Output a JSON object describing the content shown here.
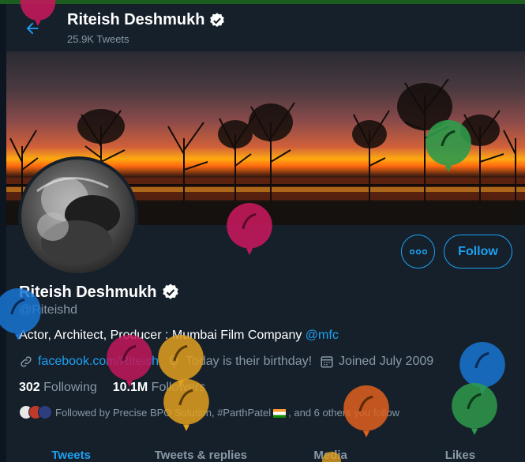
{
  "header": {
    "name": "Riteish Deshmukh",
    "tweet_count": "25.9K Tweets"
  },
  "profile": {
    "name": "Riteish Deshmukh",
    "handle": "@Riteishd",
    "bio_text": "Actor, Architect, Producer : Mumbai Film Company ",
    "bio_mention": "@mfc",
    "website": "facebook.com/Riteish",
    "birthday": "Today is their birthday!",
    "joined": "Joined July 2009",
    "following_count": "302",
    "following_label": "Following",
    "followers_count": "10.1M",
    "followers_label": "Followers",
    "followed_by_prefix": "Followed by Precise BPO Solution, #ParthPatel",
    "followed_by_suffix": ", and 6 others you follow"
  },
  "actions": {
    "follow_label": "Follow",
    "more_label": "•••"
  },
  "tabs": [
    {
      "label": "Tweets"
    },
    {
      "label": "Tweets & replies"
    },
    {
      "label": "Media"
    },
    {
      "label": "Likes"
    }
  ],
  "colors": {
    "accent": "#1da1f2",
    "background": "#15202b",
    "muted": "#8899a6"
  },
  "icons": {
    "back": "arrow-left-icon",
    "verified": "verified-badge-icon",
    "more": "ellipsis-icon",
    "link": "link-icon",
    "birthday": "balloon-icon",
    "calendar": "calendar-icon"
  }
}
